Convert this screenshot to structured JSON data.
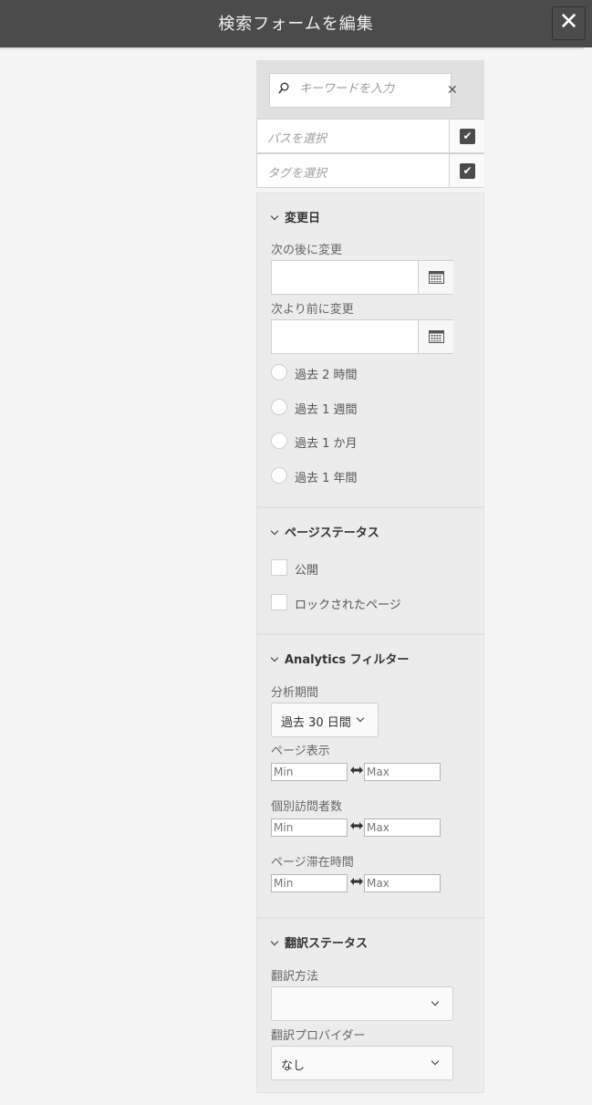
{
  "header": {
    "title": "検索フォームを編集",
    "close_label": "✕"
  },
  "keyword": {
    "placeholder": "キーワードを入力",
    "clear_label": "✕"
  },
  "path_picker": {
    "placeholder": "パスを選択"
  },
  "tag_picker": {
    "placeholder": "タグを選択"
  },
  "modified": {
    "title": "変更日",
    "after_label": "次の後に変更",
    "before_label": "次より前に変更",
    "options": [
      "過去 2 時間",
      "過去 1 週間",
      "過去 1 か月",
      "過去 1 年間"
    ]
  },
  "page_status": {
    "title": "ページステータス",
    "options": [
      "公開",
      "ロックされたページ"
    ]
  },
  "analytics": {
    "title": "Analytics フィルター",
    "period_label": "分析期間",
    "period_value": "過去 30 日間",
    "page_views_label": "ページ表示",
    "unique_visitors_label": "個別訪問者数",
    "time_on_page_label": "ページ滞在時間",
    "min_placeholder": "Min",
    "max_placeholder": "Max"
  },
  "translation": {
    "title": "翻訳ステータス",
    "method_label": "翻訳方法",
    "method_value": "",
    "provider_label": "翻訳プロバイダー",
    "provider_value": "なし"
  }
}
